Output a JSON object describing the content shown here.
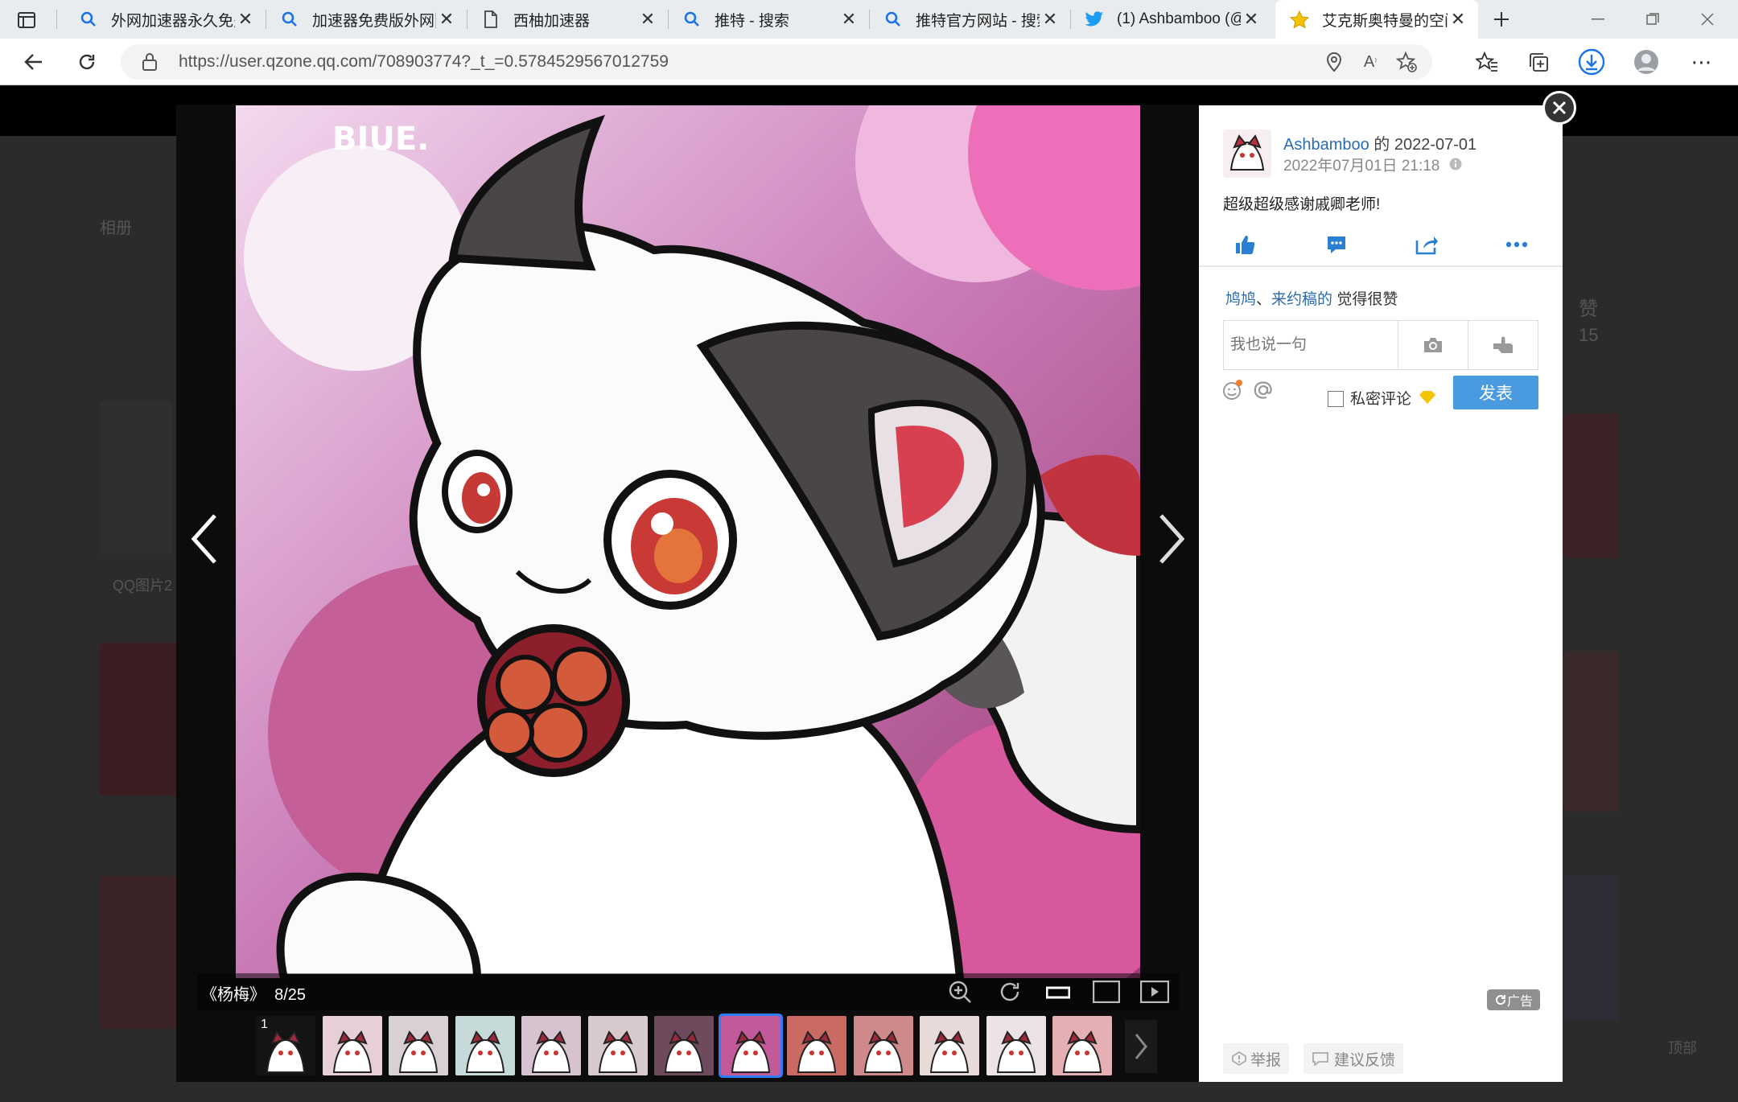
{
  "browser": {
    "tabs": [
      {
        "label": "外网加速器永久免费",
        "icon": "search-icon"
      },
      {
        "label": "加速器免费版外网🆓",
        "icon": "search-icon"
      },
      {
        "label": "西柚加速器",
        "icon": "document-icon"
      },
      {
        "label": "推特 - 搜索",
        "icon": "search-icon"
      },
      {
        "label": "推特官方网站 - 搜索",
        "icon": "search-icon"
      },
      {
        "label": "(1) Ashbamboo (@",
        "icon": "twitter-icon"
      },
      {
        "label": "艾克斯奥特曼的空间",
        "icon": "star-icon",
        "active": true
      }
    ],
    "url": "https://user.qzone.qq.com/708903774?_t_=0.5784529567012759",
    "colors": {
      "tab_bg": "#e9ecef",
      "accent": "#1a73e8",
      "download": "#1a73e8"
    }
  },
  "background_page": {
    "left_label": "相册",
    "left_caption": "QQ图片2",
    "right_label_1": "赞",
    "right_count": "15",
    "right_label_2": "顶部"
  },
  "viewer": {
    "caption_title": "《杨梅》",
    "caption_index": "8/25",
    "thumbnails": [
      {
        "label": "1"
      },
      {
        "label": ""
      },
      {
        "label": ""
      },
      {
        "label": ""
      },
      {
        "label": ""
      },
      {
        "label": ""
      },
      {
        "label": ""
      },
      {
        "label": "",
        "selected": true
      },
      {
        "label": ""
      },
      {
        "label": ""
      },
      {
        "label": ""
      },
      {
        "label": ""
      },
      {
        "label": ""
      }
    ],
    "colors": {
      "selected_outline": "#2d7ff9",
      "panel_bg": "#0c0c0c"
    }
  },
  "side": {
    "author": "Ashbamboo",
    "author_meta": " 的 2022-07-01",
    "timestamp": "2022年07月01日 21:18",
    "description": "超级超级感谢戚卿老师!",
    "likes_users": [
      "鸠鸠",
      "来约稿的"
    ],
    "likes_sep": "、",
    "likes_suffix": " 觉得很赞",
    "comment_placeholder": "我也说一句",
    "private_label": "私密评论",
    "post_button": "发表",
    "ad_label": "广告",
    "report_label": "举报",
    "feedback_label": "建议反馈",
    "colors": {
      "link": "#2b6cb0",
      "post_btn": "#4a9ae0"
    }
  }
}
